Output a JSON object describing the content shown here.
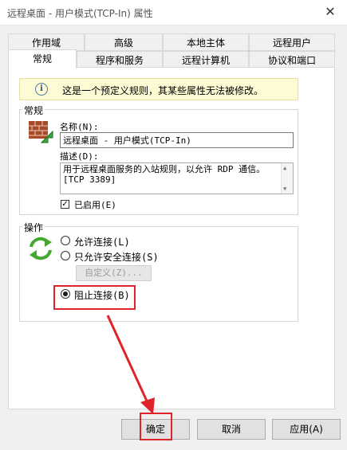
{
  "window": {
    "title": "远程桌面 - 用户模式(TCP-In) 属性",
    "close_glyph": "✕"
  },
  "tabs_row1": [
    "作用域",
    "高级",
    "本地主体",
    "远程用户"
  ],
  "tabs_row2": [
    "常规",
    "程序和服务",
    "远程计算机",
    "协议和端口"
  ],
  "active_tab": "常规",
  "info_bar": {
    "icon": "info-icon",
    "text": "这是一个预定义规则，其某些属性无法被修改。"
  },
  "general": {
    "group_label": "常规",
    "name_label": "名称(N):",
    "name_value": "远程桌面 - 用户模式(TCP-In)",
    "desc_label": "描述(D):",
    "desc_line1": "用于远程桌面服务的入站规则，以允许 RDP 通信。",
    "desc_line2": "[TCP 3389]",
    "enabled_label": "已启用(E)",
    "enabled_checked": true,
    "check_glyph": "✓"
  },
  "action": {
    "group_label": "操作",
    "allow": "允许连接(L)",
    "allow_secure": "只允许安全连接(S)",
    "customize": "自定义(Z)...",
    "block": "阻止连接(B)",
    "selected": "block"
  },
  "buttons": {
    "ok": "确定",
    "cancel": "取消",
    "apply": "应用(A)"
  },
  "colors": {
    "highlight": "#e0222a",
    "info_bg": "#fdfbd4",
    "panel_bg": "#ffffff"
  }
}
